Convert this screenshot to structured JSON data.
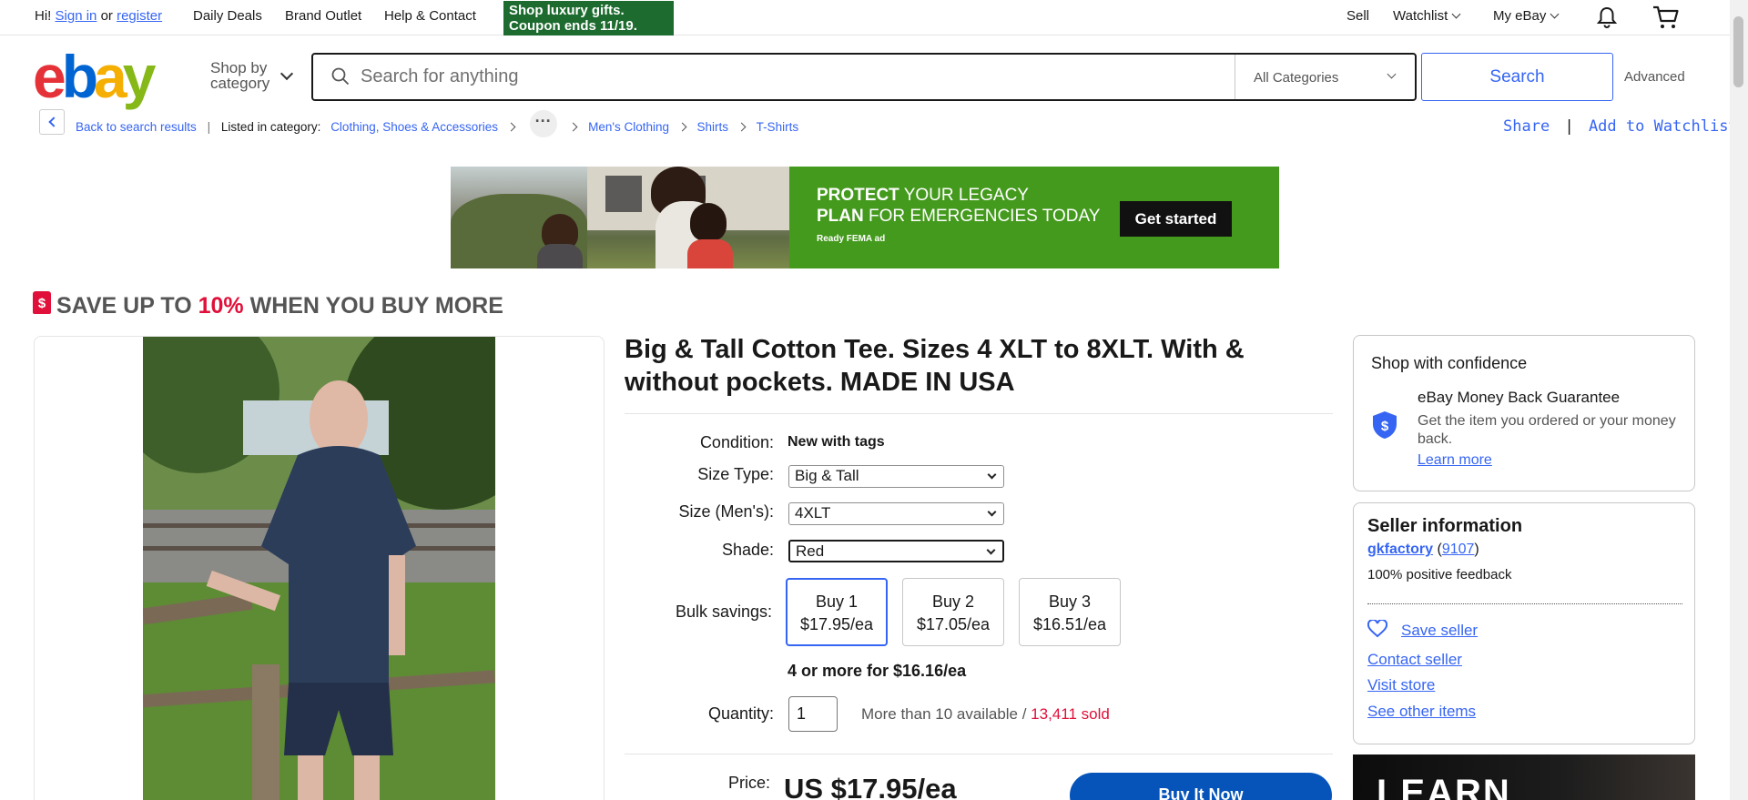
{
  "topbar": {
    "greeting": "Hi!",
    "sign_in": "Sign in",
    "or": "or",
    "register": "register",
    "daily_deals": "Daily Deals",
    "brand_outlet": "Brand Outlet",
    "help": "Help & Contact",
    "promo_line1": "Shop luxury gifts.",
    "promo_line2": "Coupon ends 11/19.",
    "sell": "Sell",
    "watchlist": "Watchlist",
    "my_ebay": "My eBay",
    "icons": [
      "bell-icon",
      "cart-icon"
    ]
  },
  "header": {
    "logo": [
      "e",
      "b",
      "a",
      "y"
    ],
    "shop_by_line1": "Shop by",
    "shop_by_line2": "category",
    "search_placeholder": "Search for anything",
    "category": "All Categories",
    "search_button": "Search",
    "advanced": "Advanced"
  },
  "breadcrumb": {
    "back": "Back to search results",
    "separator": "|",
    "listed_in": "Listed in category:",
    "items": [
      "Clothing, Shoes & Accessories",
      "Men's Clothing",
      "Shirts",
      "T-Shirts"
    ],
    "dots": "···",
    "share": "Share",
    "bar": "|",
    "add_watchlist": "Add to Watchlist"
  },
  "ad": {
    "line1_bold": "PROTECT",
    "line1_rest": " YOUR LEGACY",
    "line2_bold": "PLAN",
    "line2_rest": " FOR EMERGENCIES TODAY",
    "logos": "Ready   FEMA   ad",
    "cta": "Get started",
    "color": "#449a1d"
  },
  "save_banner": {
    "tag": "$",
    "prefix": "SAVE UP TO ",
    "pct": "10%",
    "suffix": " WHEN YOU BUY MORE"
  },
  "item": {
    "title": "Big & Tall Cotton Tee. Sizes 4 XLT to 8XLT. With & without pockets. MADE IN USA",
    "condition_label": "Condition:",
    "condition": "New with tags",
    "size_type_label": "Size Type:",
    "size_type": "Big & Tall",
    "size_label": "Size (Men's):",
    "size": "4XLT",
    "shade_label": "Shade:",
    "shade": "Red",
    "bulk_label": "Bulk savings:",
    "bulk": [
      {
        "qty": "Buy 1",
        "price": "$17.95/ea"
      },
      {
        "qty": "Buy 2",
        "price": "$17.05/ea"
      },
      {
        "qty": "Buy 3",
        "price": "$16.51/ea"
      }
    ],
    "bulk_more": "4 or more for $16.16/ea",
    "quantity_label": "Quantity:",
    "quantity": "1",
    "available": "More than 10 available / ",
    "sold": "13,411 sold",
    "price_label": "Price:",
    "price": "US $17.95/ea",
    "buy_now": "Buy It Now"
  },
  "confidence": {
    "title": "Shop with confidence",
    "mbg_title": "eBay Money Back Guarantee",
    "mbg_desc": "Get the item you ordered or your money back.",
    "learn_more": "Learn more"
  },
  "seller": {
    "title": "Seller information",
    "name": "gkfactory",
    "open": " (",
    "score": "9107",
    "close": ")",
    "feedback": "100% positive feedback",
    "save_seller": "Save seller",
    "contact": "Contact seller",
    "visit": "Visit store",
    "other": "See other items"
  },
  "side_ad": {
    "text": "LEARN"
  },
  "colors": {
    "accent": "#3665f3",
    "red": "#e0103a",
    "buy_now": "#0654ba"
  }
}
